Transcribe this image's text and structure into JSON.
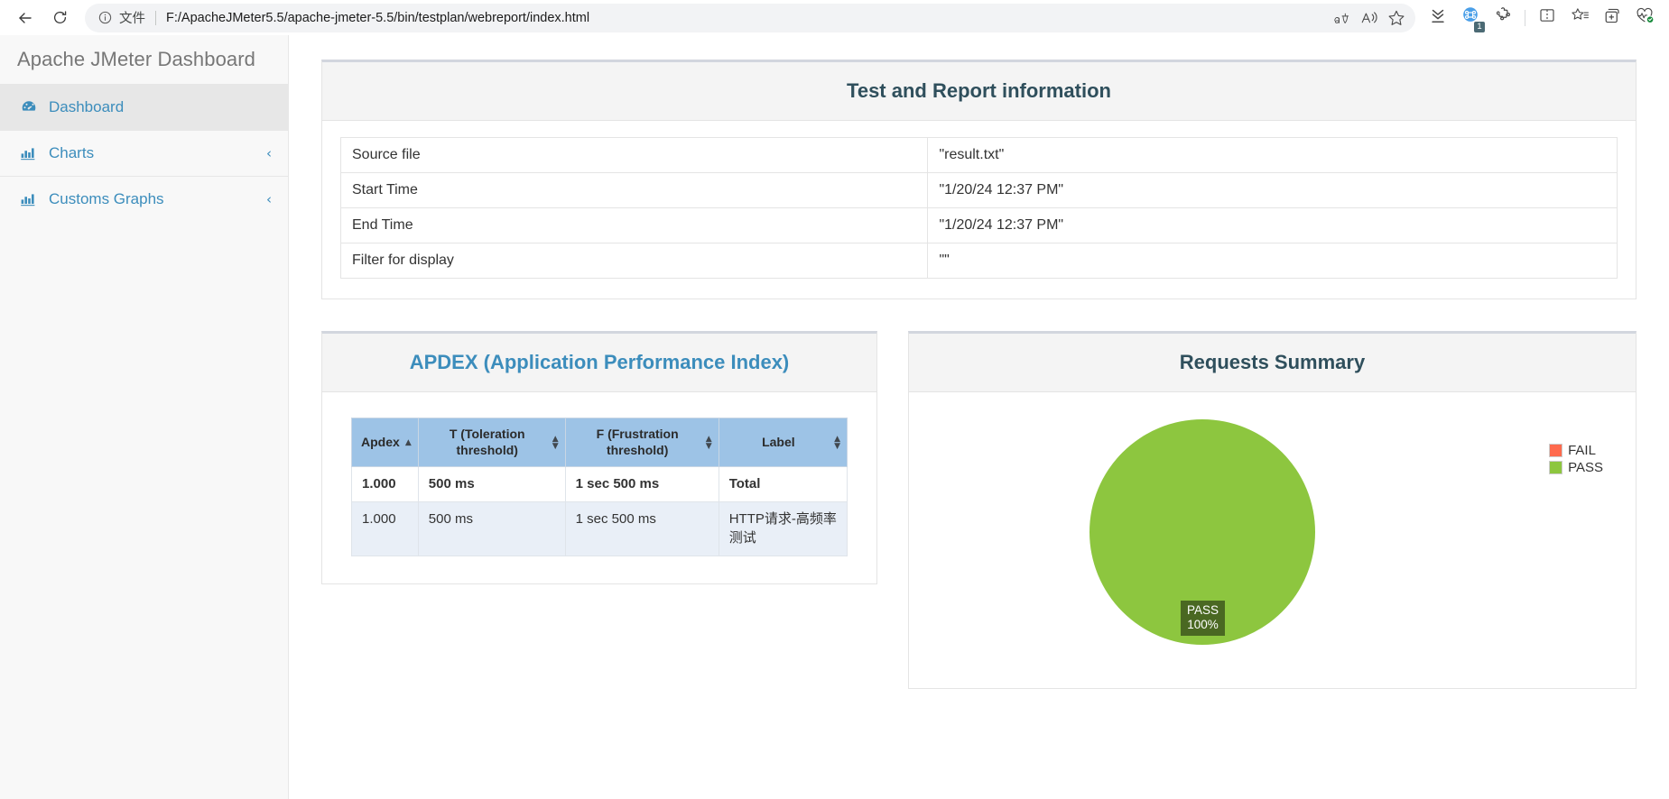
{
  "browser": {
    "back_icon": "back-arrow-icon",
    "reload_icon": "reload-icon",
    "info_icon": "info-circle-icon",
    "file_label": "文件",
    "url": "F:/ApacheJMeter5.5/apache-jmeter-5.5/bin/testplan/webreport/index.html",
    "translate_icon": "translate-icon",
    "read_aloud_icon": "read-aloud-icon",
    "favorite_icon": "star-outline-icon",
    "downloads_icon": "downloads-icon",
    "extension_icon": "extension-puzzle-icon",
    "extension_badge": "1",
    "collections_icon": "split-screen-icon",
    "favorites_bar_icon": "favorites-list-icon",
    "add_collection_icon": "add-collection-icon",
    "browser_essentials_icon": "browser-essentials-icon"
  },
  "sidebar": {
    "brand": "Apache JMeter Dashboard",
    "items": [
      {
        "label": "Dashboard",
        "icon": "dashboard-speedometer-icon",
        "active": true,
        "chevron": ""
      },
      {
        "label": "Charts",
        "icon": "bar-chart-icon",
        "active": false,
        "chevron": "‹"
      },
      {
        "label": "Customs Graphs",
        "icon": "bar-chart-icon",
        "active": false,
        "chevron": "‹"
      }
    ]
  },
  "test_report": {
    "title": "Test and Report information",
    "rows": [
      {
        "key": "Source file",
        "value": "\"result.txt\""
      },
      {
        "key": "Start Time",
        "value": "\"1/20/24 12:37 PM\""
      },
      {
        "key": "End Time",
        "value": "\"1/20/24 12:37 PM\""
      },
      {
        "key": "Filter for display",
        "value": "\"\""
      }
    ]
  },
  "apdex": {
    "title": "APDEX (Application Performance Index)",
    "columns": [
      {
        "label": "Apdex",
        "sort": "asc"
      },
      {
        "label": "T (Toleration threshold)",
        "sort": "none"
      },
      {
        "label": "F (Frustration threshold)",
        "sort": "none"
      },
      {
        "label": "Label",
        "sort": "none"
      }
    ],
    "rows": [
      {
        "apdex": "1.000",
        "t": "500 ms",
        "f": "1 sec 500 ms",
        "label": "Total"
      },
      {
        "apdex": "1.000",
        "t": "500 ms",
        "f": "1 sec 500 ms",
        "label": "HTTP请求-高频率测试"
      }
    ]
  },
  "requests_summary": {
    "title": "Requests Summary",
    "legend": [
      {
        "name": "FAIL",
        "color": "#ff6a4d"
      },
      {
        "name": "PASS",
        "color": "#8dc63f"
      }
    ],
    "slice_label_top": "PASS",
    "slice_label_bottom": "100%"
  },
  "chart_data": {
    "type": "pie",
    "title": "Requests Summary",
    "categories": [
      "FAIL",
      "PASS"
    ],
    "values": [
      0,
      100
    ],
    "unit": "%",
    "colors": [
      "#ff6a4d",
      "#8dc63f"
    ],
    "labels": [
      "",
      "PASS 100%"
    ],
    "legend_position": "right"
  }
}
